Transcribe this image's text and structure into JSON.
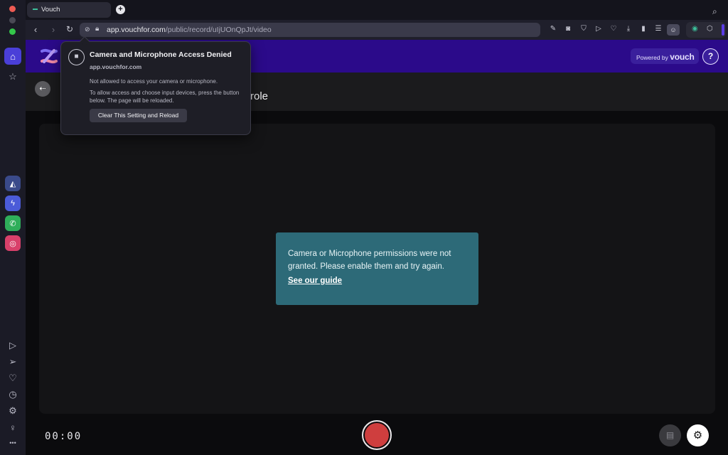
{
  "browser": {
    "tab_title": "Vouch",
    "new_tab_label": "+",
    "url_host": "app.vouchfor.com",
    "url_path": "/public/record/uIjUOnQpJt/video"
  },
  "sidebar": {
    "items": [
      "home-icon",
      "star-icon"
    ],
    "apps": [
      "app-icon",
      "messenger-icon",
      "whatsapp-icon",
      "instagram-icon"
    ],
    "bottom": [
      "player-icon",
      "send-icon",
      "heart-icon",
      "history-icon",
      "gear-icon",
      "tips-icon",
      "more-icon"
    ],
    "more_label": "•••"
  },
  "header": {
    "powered_prefix": "Powered by",
    "powered_brand": "vouch",
    "help_label": "?"
  },
  "subheader": {
    "title_left": "",
    "title_fragment": "role"
  },
  "notice": {
    "text": "Camera or Microphone permissions were not granted. Please enable them and try again.",
    "link": "See our guide"
  },
  "recorder": {
    "timer": "00:00"
  },
  "popup": {
    "title": "Camera and Microphone Access Denied",
    "host": "app.vouchfor.com",
    "message1": "Not allowed to access your camera or microphone.",
    "message2": "To allow access and choose input devices, press the button below. The page will be reloaded.",
    "button": "Clear This Setting and Reload"
  },
  "colors": {
    "brand_bar": "#2b0a8a",
    "notice_bg": "#2d6a78",
    "record_button": "#cf3e3e"
  }
}
